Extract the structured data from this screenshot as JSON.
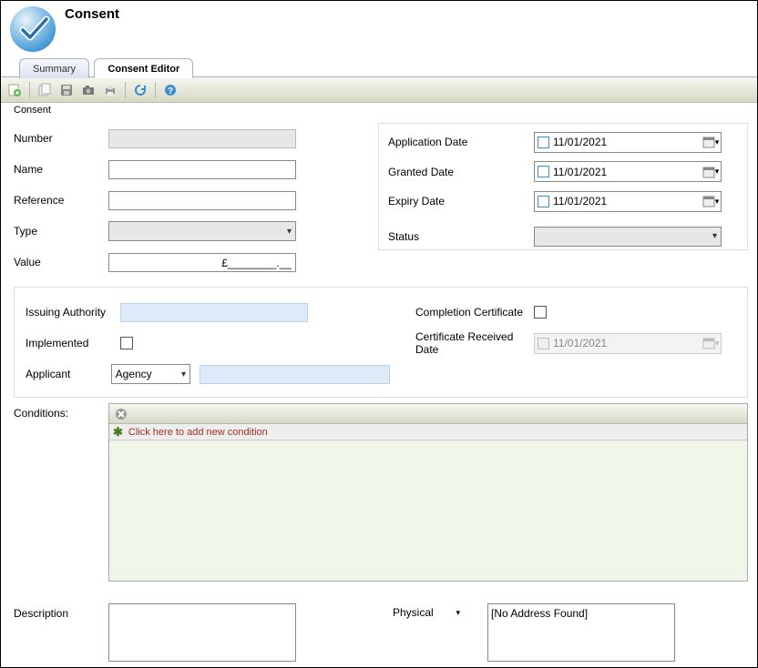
{
  "title": "Consent",
  "tabs": {
    "summary": "Summary",
    "editor": "Consent Editor"
  },
  "section_label": "Consent",
  "left": {
    "number": "Number",
    "name": "Name",
    "reference": "Reference",
    "type": "Type",
    "value": "Value",
    "value_text": "£________.__"
  },
  "right": {
    "application_date": "Application Date",
    "granted_date": "Granted Date",
    "expiry_date": "Expiry Date",
    "status": "Status",
    "date_val": "11/01/2021"
  },
  "second": {
    "issuing_authority": "Issuing Authority",
    "implemented": "Implemented",
    "applicant": "Applicant",
    "applicant_value": "Agency",
    "completion_cert": "Completion Certificate",
    "cert_received": "Certificate Received Date",
    "cert_date": "11/01/2021"
  },
  "conditions": {
    "label": "Conditions:",
    "add_text": "Click here to add new condition"
  },
  "desc": {
    "description": "Description",
    "physical": "Physical",
    "no_address": "[No Address Found]"
  }
}
